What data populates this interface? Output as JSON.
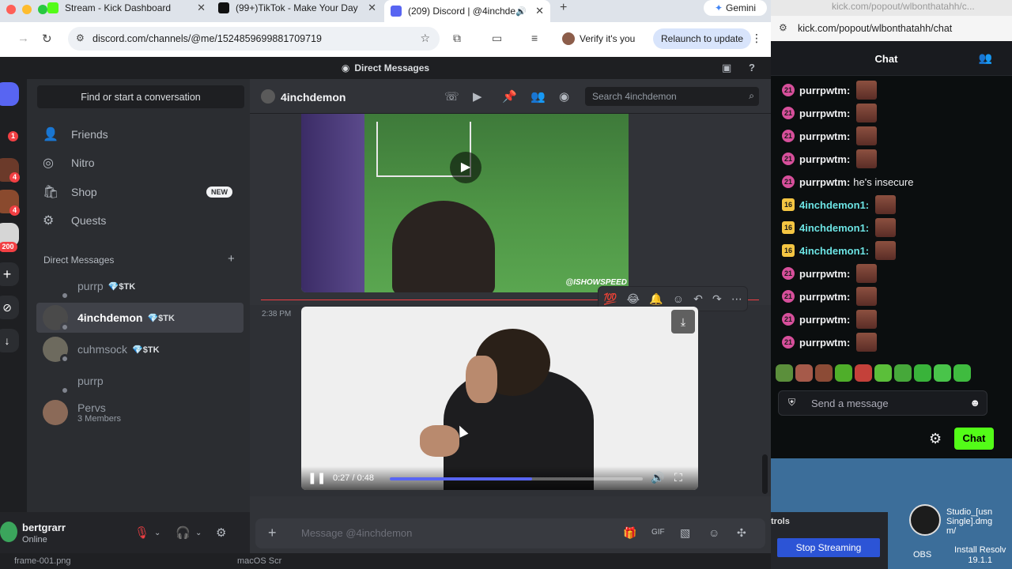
{
  "browser": {
    "tabs": [
      {
        "label": "Stream - Kick Dashboard",
        "favicon_color": "#53fc18"
      },
      {
        "label": "(99+)TikTok - Make Your Day",
        "favicon_color": "#111111"
      },
      {
        "label": "(209) Discord | @4inchde",
        "favicon_color": "#5865f2"
      }
    ],
    "gemini_label": "Gemini",
    "url": "discord.com/channels/@me/1524859699881709719",
    "verify_label": "Verify it's you",
    "relaunch_label": "Relaunch to update"
  },
  "discord": {
    "window_title": "Direct Messages",
    "rail_badges": [
      "1",
      "4",
      "4",
      "200"
    ],
    "find_placeholder": "Find or start a conversation",
    "nav": [
      {
        "label": "Friends",
        "icon": "friends-icon"
      },
      {
        "label": "Nitro",
        "icon": "nitro-icon"
      },
      {
        "label": "Shop",
        "icon": "shop-icon",
        "badge": "NEW"
      },
      {
        "label": "Quests",
        "icon": "quests-icon"
      }
    ],
    "dm_header": "Direct Messages",
    "dms": [
      {
        "name": "purrp",
        "tag": "💎$TK"
      },
      {
        "name": "4inchdemon",
        "tag": "💎$TK",
        "active": true
      },
      {
        "name": "cuhmsock",
        "tag": "💎$TK"
      },
      {
        "name": "purrp",
        "tag": ""
      },
      {
        "name": "Pervs",
        "sub": "3 Members"
      }
    ],
    "user": {
      "name": "bertgrarr",
      "status": "Online"
    },
    "chat": {
      "title": "4inchdemon",
      "search_placeholder": "Search 4inchdemon",
      "video1_watermark": "@ISHOWSPEED",
      "timestamp": "2:38 PM",
      "video2_time": "0:27 / 0:48",
      "video2_progress": 0.5625,
      "composer_placeholder": "Message @4inchdemon"
    },
    "bottom_items": [
      "frame-001.png",
      "macOS Scr"
    ]
  },
  "kick": {
    "window_title": "kick.com/popout/wlbonthatahh/c...",
    "address": "kick.com/popout/wlbonthatahh/chat",
    "header": "Chat",
    "messages": [
      {
        "badge": "21",
        "user": "purrpwtm:",
        "text": "",
        "emote": true
      },
      {
        "badge": "21",
        "user": "purrpwtm:",
        "text": "",
        "emote": true
      },
      {
        "badge": "21",
        "user": "purrpwtm:",
        "text": "",
        "emote": true
      },
      {
        "badge": "21",
        "user": "purrpwtm:",
        "text": "",
        "emote": true
      },
      {
        "badge": "21",
        "user": "purrpwtm:",
        "text": "he's insecure",
        "emote": false
      },
      {
        "badge": "16",
        "user": "4inchdemon1:",
        "text": "",
        "emote": true,
        "color": "#6ce3e3"
      },
      {
        "badge": "16",
        "user": "4inchdemon1:",
        "text": "",
        "emote": true,
        "color": "#6ce3e3"
      },
      {
        "badge": "16",
        "user": "4inchdemon1:",
        "text": "",
        "emote": true,
        "color": "#6ce3e3"
      },
      {
        "badge": "21",
        "user": "purrpwtm:",
        "text": "",
        "emote": true
      },
      {
        "badge": "21",
        "user": "purrpwtm:",
        "text": "",
        "emote": true
      },
      {
        "badge": "21",
        "user": "purrpwtm:",
        "text": "",
        "emote": true
      },
      {
        "badge": "21",
        "user": "purrpwtm:",
        "text": "",
        "emote": true
      }
    ],
    "input_placeholder": "Send a message",
    "chat_button": "Chat"
  },
  "desktop": {
    "obs_label": "OBS",
    "controls_label": "trols",
    "stop_streaming": "Stop Streaming",
    "file_label": "Studio_[usn\nSingle].dmg\nm/",
    "resolve_label": "Install Resolv\n19.1.1"
  }
}
